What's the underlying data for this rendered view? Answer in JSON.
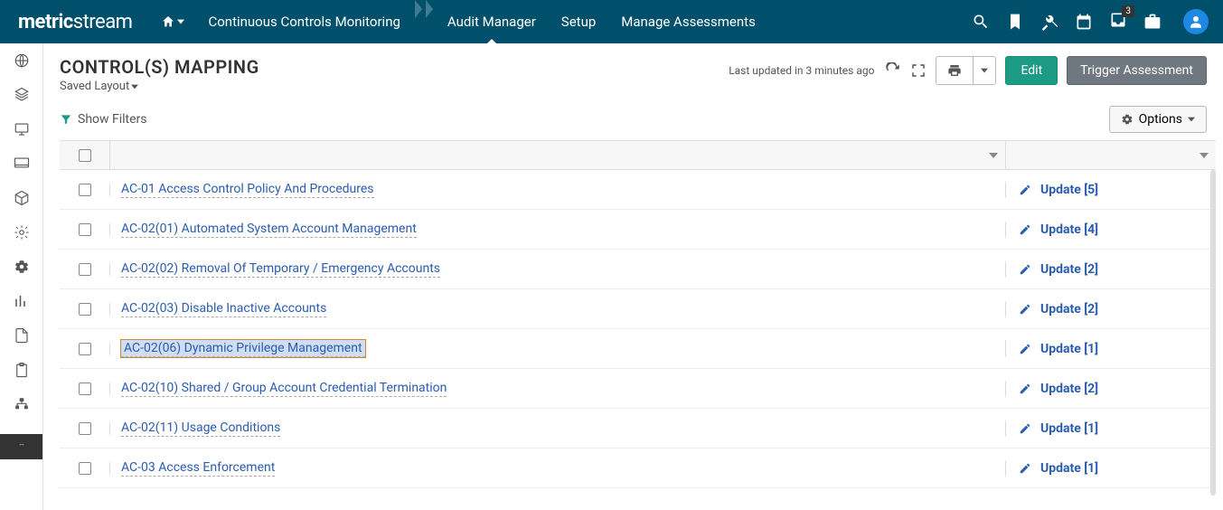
{
  "brand": "metricstream",
  "nav": {
    "items": [
      "Continuous Controls Monitoring",
      "Audit Manager",
      "Setup",
      "Manage Assessments"
    ],
    "active": 1,
    "notification_count": "3"
  },
  "page": {
    "title": "CONTROL(S) MAPPING",
    "saved_layout": "Saved Layout",
    "last_updated": "Last updated in 3 minutes ago",
    "edit": "Edit",
    "trigger": "Trigger Assessment",
    "show_filters": "Show Filters",
    "options": "Options"
  },
  "rows": [
    {
      "label": "AC-01 Access Control Policy And Procedures",
      "action": "Update [5]",
      "selected": false
    },
    {
      "label": "AC-02(01) Automated System Account Management",
      "action": "Update [4]",
      "selected": false
    },
    {
      "label": "AC-02(02) Removal Of Temporary / Emergency Accounts",
      "action": "Update [2]",
      "selected": false
    },
    {
      "label": "AC-02(03) Disable Inactive Accounts",
      "action": "Update [2]",
      "selected": false
    },
    {
      "label": "AC-02(06) Dynamic Privilege Management",
      "action": "Update [1]",
      "selected": true
    },
    {
      "label": "AC-02(10) Shared / Group Account Credential Termination",
      "action": "Update [2]",
      "selected": false
    },
    {
      "label": "AC-02(11) Usage Conditions",
      "action": "Update [1]",
      "selected": false
    },
    {
      "label": "AC-03 Access Enforcement",
      "action": "Update [1]",
      "selected": false
    }
  ]
}
